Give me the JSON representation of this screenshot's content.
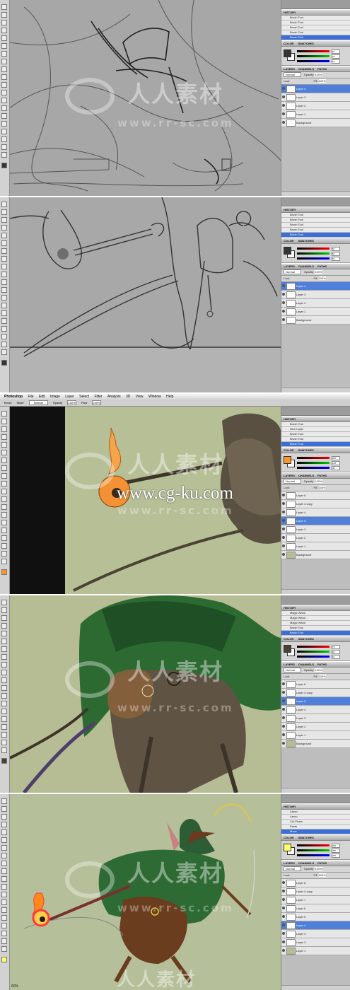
{
  "app": {
    "name": "Photoshop"
  },
  "menu": [
    "Photoshop",
    "File",
    "Edit",
    "Image",
    "Layer",
    "Select",
    "Filter",
    "Analysis",
    "3D",
    "View",
    "Window",
    "Help"
  ],
  "options": {
    "tool": "Brush",
    "mode_label": "Mode",
    "mode_value": "Normal",
    "opacity_label": "Opacity",
    "opacity_value": "100%",
    "flow_label": "Flow",
    "flow_value": "100%"
  },
  "panel_labels": {
    "history": "HISTORY",
    "color": "COLOR",
    "swatches": "SWATCHES",
    "layers": "LAYERS",
    "channels": "CHANNELS",
    "paths": "PATHS",
    "normal": "Normal",
    "opacity": "Opacity",
    "fill": "Fill",
    "lock": "Lock",
    "pct": "100%"
  },
  "frames": [
    {
      "history": [
        "Brush Tool",
        "Brush Tool",
        "Brush Tool",
        "Brush Tool",
        "Brush Tool"
      ],
      "color": {
        "r": "52",
        "g": "52",
        "b": "52",
        "fg": "#343434"
      },
      "layers": [
        "Layer 4",
        "Layer 3",
        "Layer 2",
        "Layer 1",
        "Background"
      ],
      "selected": 0
    },
    {
      "history": [
        "Brush Tool",
        "Brush Tool",
        "Brush Tool",
        "Brush Tool",
        "Brush Tool"
      ],
      "color": {
        "r": "52",
        "g": "52",
        "b": "52",
        "fg": "#343434"
      },
      "layers": [
        "Layer 4",
        "Layer 3",
        "Layer 2",
        "Layer 1",
        "Background"
      ],
      "selected": 0
    },
    {
      "history": [
        "Brush Tool",
        "New Layer",
        "Brush Tool",
        "Brush Tool",
        "Brush Tool"
      ],
      "color": {
        "r": "255",
        "g": "148",
        "b": "40",
        "fg": "#ff9428"
      },
      "layers": [
        "Layer 6",
        "Layer 4 copy",
        "Layer 4",
        "Layer 5",
        "Layer 3",
        "Layer 2",
        "Layer 1",
        "Background"
      ],
      "selected": 3
    },
    {
      "history": [
        "Magic Wand",
        "Magic Wand",
        "Magic Wand",
        "Brush Tool",
        "Brush Tool"
      ],
      "color": {
        "r": "73",
        "g": "63",
        "b": "52",
        "fg": "#493f34"
      },
      "layers": [
        "Layer 6",
        "Layer 4 copy",
        "Layer 5",
        "Layer 4",
        "Layer 3",
        "Layer 2",
        "Layer 1",
        "Background"
      ],
      "selected": 2
    },
    {
      "history": [
        "Lasso",
        "Lasso",
        "Cut Pixels",
        "Paste",
        "Move"
      ],
      "color": {
        "r": "255",
        "g": "255",
        "b": "255",
        "fg": "#ffff66"
      },
      "layers": [
        "Layer 8",
        "Layer 4 copy",
        "Layer 7",
        "Layer 6",
        "Layer 5",
        "Layer 4",
        "Layer 3",
        "Layer 2",
        "Layer 1"
      ],
      "selected": 5
    }
  ],
  "status": {
    "zoom": "60%"
  },
  "watermark": {
    "chinese": "人人素材",
    "url": "www.rr-sc.com",
    "overlay": "www.cg-ku.com"
  }
}
